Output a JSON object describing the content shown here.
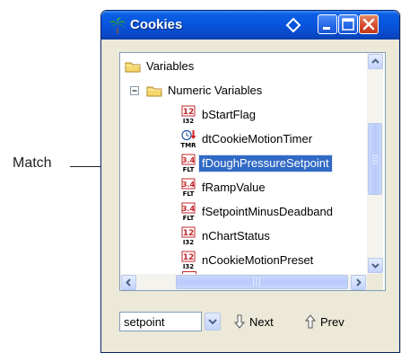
{
  "callout": {
    "label": "Match"
  },
  "window": {
    "title": "Cookies",
    "title_icon": "palm-tree-icon"
  },
  "tree": {
    "items": [
      {
        "label": "Variables",
        "icon": "folder-icon"
      },
      {
        "label": "Numeric Variables",
        "icon": "folder-icon",
        "expander": "⊟"
      },
      {
        "label": "bStartFlag",
        "icon": "int-type-icon",
        "badge_top": "12",
        "badge_bottom": "I32"
      },
      {
        "label": "dtCookieMotionTimer",
        "icon": "timer-type-icon",
        "badge_bottom": "TMR"
      },
      {
        "label": "fDoughPressureSetpoint",
        "icon": "float-type-icon",
        "badge_top": "3.4",
        "badge_bottom": "FLT",
        "selected": true
      },
      {
        "label": "fRampValue",
        "icon": "float-type-icon",
        "badge_top": "3.4",
        "badge_bottom": "FLT"
      },
      {
        "label": "fSetpointMinusDeadband",
        "icon": "float-type-icon",
        "badge_top": "3.4",
        "badge_bottom": "FLT"
      },
      {
        "label": "nChartStatus",
        "icon": "int-type-icon",
        "badge_top": "12",
        "badge_bottom": "I32"
      },
      {
        "label": "nCookieMotionPreset",
        "icon": "int-type-icon",
        "badge_top": "12",
        "badge_bottom": "I32"
      }
    ],
    "hscroll_grip": "|||"
  },
  "search": {
    "value": "setpoint"
  },
  "buttons": {
    "next_label": "Next",
    "prev_label": "Prev"
  },
  "colors": {
    "titlebar": "#0854de",
    "selection": "#316ac5",
    "frame": "#ece9d8"
  }
}
